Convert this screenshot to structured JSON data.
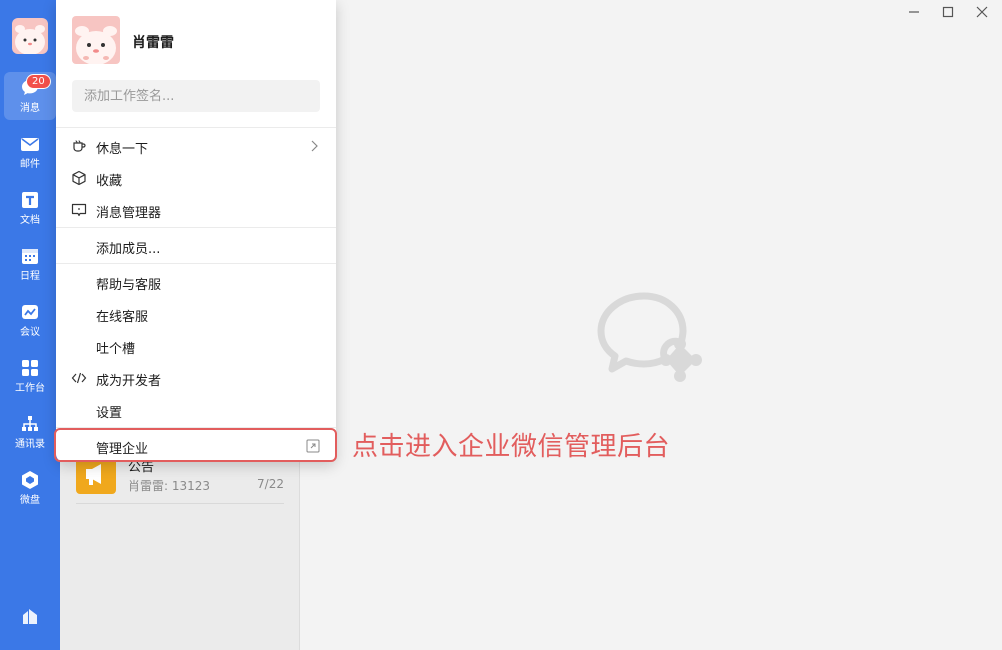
{
  "profile": {
    "name": "肖雷雷",
    "signature_placeholder": "添加工作签名..."
  },
  "rail": {
    "items": [
      {
        "label": "消息",
        "icon": "chat-bubble-icon",
        "badge": "20"
      },
      {
        "label": "邮件",
        "icon": "mail-icon"
      },
      {
        "label": "文档",
        "icon": "document-icon"
      },
      {
        "label": "日程",
        "icon": "calendar-icon"
      },
      {
        "label": "会议",
        "icon": "meeting-icon"
      },
      {
        "label": "工作台",
        "icon": "workbench-icon"
      },
      {
        "label": "通讯录",
        "icon": "contacts-icon"
      },
      {
        "label": "微盘",
        "icon": "cloud-drive-icon"
      }
    ]
  },
  "menu": {
    "items": [
      {
        "label": "休息一下",
        "icon": "cup-icon",
        "chevron": true
      },
      {
        "label": "收藏",
        "icon": "cube-icon"
      },
      {
        "label": "消息管理器",
        "icon": "message-manager-icon"
      },
      {
        "label": "添加成员..."
      },
      {
        "label": "帮助与客服"
      },
      {
        "label": "在线客服"
      },
      {
        "label": "吐个槽"
      },
      {
        "label": "成为开发者",
        "icon": "code-icon"
      },
      {
        "label": "设置"
      },
      {
        "label": "管理企业",
        "icon": "external-link-icon"
      }
    ]
  },
  "conversation": {
    "title": "公告",
    "preview": "肖雷雷: 13123",
    "date": "7/22"
  },
  "annotation": "点击进入企业微信管理后台",
  "colors": {
    "rail": "#3b78e7",
    "highlight": "#e25d5d",
    "badge": "#f2504b",
    "announcement": "#f0a81d"
  }
}
